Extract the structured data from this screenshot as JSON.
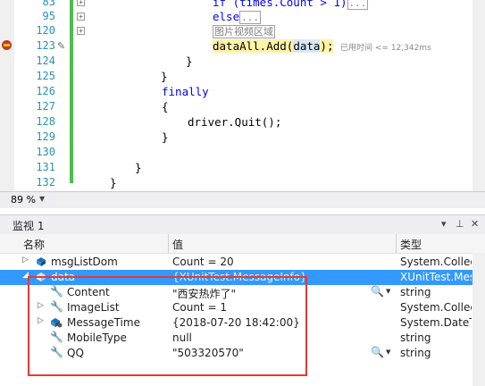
{
  "editor": {
    "lines": [
      {
        "n": "83",
        "text_prefix": "if (times.Count > 1)",
        "collapsed": "..."
      },
      {
        "n": "95",
        "text_prefix": "else",
        "collapsed": "..."
      },
      {
        "n": "120",
        "region": "图片视频区域"
      },
      {
        "n": "123",
        "call_a": "dataAll.Add(",
        "arg": "data",
        "call_b": ");",
        "perf": "已用时间 <= 12,342ms"
      },
      {
        "n": "124",
        "text": "}"
      },
      {
        "n": "125",
        "text": "}"
      },
      {
        "n": "126",
        "keyword": "finally"
      },
      {
        "n": "127",
        "text": "{"
      },
      {
        "n": "128",
        "text": "driver.Quit();"
      },
      {
        "n": "129",
        "text": "}"
      },
      {
        "n": "130",
        "text": ""
      },
      {
        "n": "131",
        "text": "}"
      },
      {
        "n": "132",
        "text": "}"
      }
    ],
    "zoom": "89 %",
    "change_bar_color": "#4cbf4c"
  },
  "watch": {
    "title": "监视 1",
    "columns": {
      "name": "名称",
      "value": "值",
      "type": "类型"
    },
    "rows": [
      {
        "name": "msgListDom",
        "value": "Count = 20",
        "type": "System.Collect",
        "icon": "field-icon",
        "expander": "collapsed"
      },
      {
        "name": "data",
        "value": "{XUnitTest.MessageInfo}",
        "type": "XUnitTest.Mess",
        "icon": "field-icon",
        "expander": "expanded",
        "selected": true
      },
      {
        "name": "Content",
        "value": "\"西安热炸了\"",
        "type": "string",
        "icon": "wrench-icon",
        "magnifier": true
      },
      {
        "name": "ImageList",
        "value": "Count = 1",
        "type": "System.Collect",
        "icon": "wrench-icon",
        "expander": "collapsed"
      },
      {
        "name": "MessageTime",
        "value": "{2018-07-20 18:42:00}",
        "type": "System.DateTir",
        "icon": "property-icon",
        "expander": "collapsed"
      },
      {
        "name": "MobileType",
        "value": "null",
        "type": "string",
        "icon": "wrench-icon"
      },
      {
        "name": "QQ",
        "value": "\"503320570\"",
        "type": "string",
        "icon": "wrench-icon",
        "magnifier": true
      }
    ]
  },
  "colors": {
    "selection": "#3399ff",
    "keyword": "#0000ff",
    "line_number": "#2b91af",
    "annotation_box": "#e53935"
  }
}
